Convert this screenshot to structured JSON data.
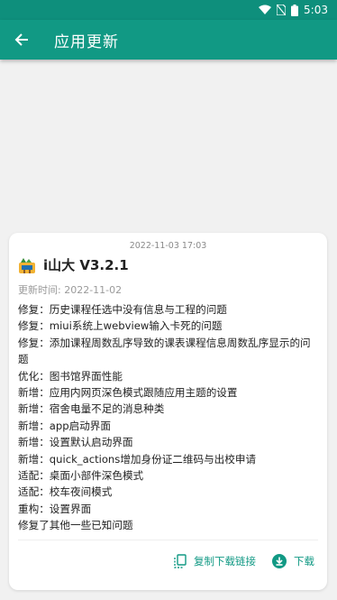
{
  "status_bar": {
    "time": "5:03"
  },
  "app_bar": {
    "title": "应用更新"
  },
  "release": {
    "published": "2022-11-03 17:03",
    "app_name_version": "i山大 V3.2.1",
    "update_time": "更新时间: 2022-11-02",
    "changes": [
      "修复：历史课程任选中没有信息与工程的问题",
      "修复：miui系统上webview输入卡死的问题",
      "修复：添加课程周数乱序导致的课表课程信息周数乱序显示的问题",
      "优化：图书馆界面性能",
      "新增：应用内网页深色模式跟随应用主题的设置",
      "新增：宿舍电量不足的消息种类",
      "新增：app启动界面",
      "新增：设置默认启动界面",
      "新增：quick_actions增加身份证二维码与出校申请",
      "适配：桌面小部件深色模式",
      "适配：校车夜间模式",
      "重构：设置界面",
      "修复了其他一些已知问题"
    ]
  },
  "actions": {
    "copy_link": "复制下载链接",
    "download": "下载"
  },
  "colors": {
    "accent": "#119984",
    "status_bar": "#0e8f7c"
  }
}
